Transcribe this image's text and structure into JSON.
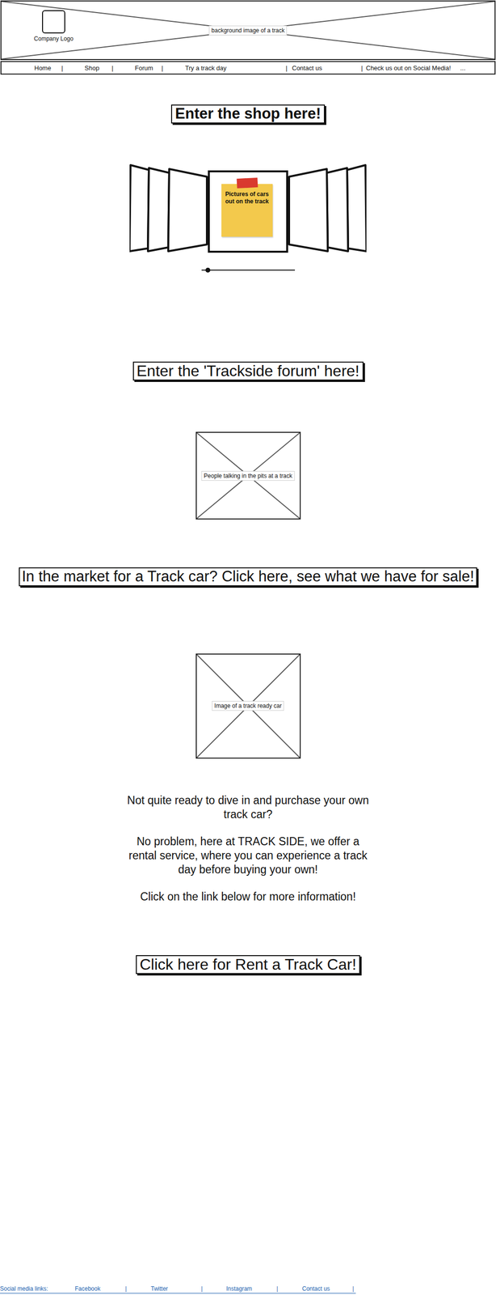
{
  "header": {
    "logo_label": "Company Logo",
    "background_label": "background image of a track"
  },
  "nav": {
    "items": [
      "Home",
      "Shop",
      "Forum",
      "Try a track day",
      "Contact us",
      "Check us out on Social Media!"
    ],
    "separator": "|",
    "more": "..."
  },
  "shop": {
    "button": "Enter the shop here!",
    "carousel": {
      "caption": "Pictures of cars out on the track",
      "level": 0.07
    }
  },
  "forum": {
    "button": "Enter the 'Trackside forum' here!",
    "image_label": "People talking in the pits at a track"
  },
  "sale": {
    "button": "In the market for a Track car? Click here, see what we have for sale!",
    "image_label": "Image of a track ready car"
  },
  "rental": {
    "paragraphs": [
      "Not quite ready to dive in and purchase your own track car?",
      "No problem, here at TRACK SIDE, we offer a rental service, where you can experience a track day before buying your own!",
      "Click on the link below for more information!"
    ],
    "button": "Click here for Rent a Track Car!"
  },
  "footer": {
    "label": "Social media links:",
    "links": [
      "Facebook",
      "Twitter",
      "Instagram",
      "Contact us"
    ],
    "separator": "|"
  }
}
